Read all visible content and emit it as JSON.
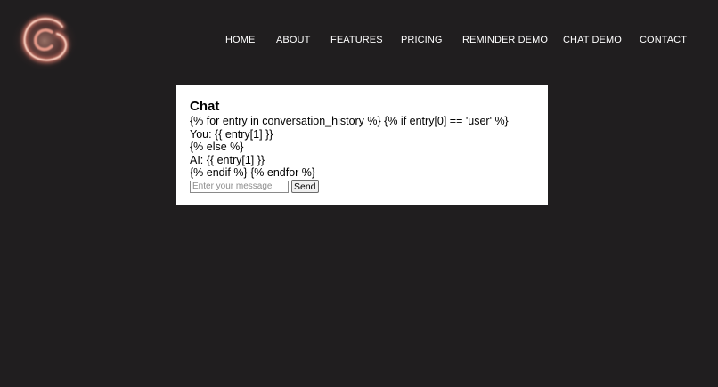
{
  "header": {
    "logo_icon": "swirl-logo-icon",
    "nav_items": [
      {
        "label": "HOME"
      },
      {
        "label": "ABOUT"
      },
      {
        "label": "FEATURES"
      },
      {
        "label": "PRICING"
      },
      {
        "label": "REMINDER DEMO"
      },
      {
        "label": "CHAT DEMO"
      },
      {
        "label": "CONTACT"
      }
    ]
  },
  "chat": {
    "title": "Chat",
    "lines": [
      "{% for entry in conversation_history %} {% if entry[0] == 'user' %}",
      "You: {{ entry[1] }}",
      "{% else %}",
      "AI: {{ entry[1] }}",
      "{% endif %} {% endfor %}"
    ],
    "input": {
      "value": "",
      "placeholder": "Enter your message"
    },
    "send_label": "Send"
  },
  "colors": {
    "background": "#201e1f",
    "panel": "#ffffff",
    "nav_text": "#ffffff",
    "logo_glow": "#e9927e"
  }
}
